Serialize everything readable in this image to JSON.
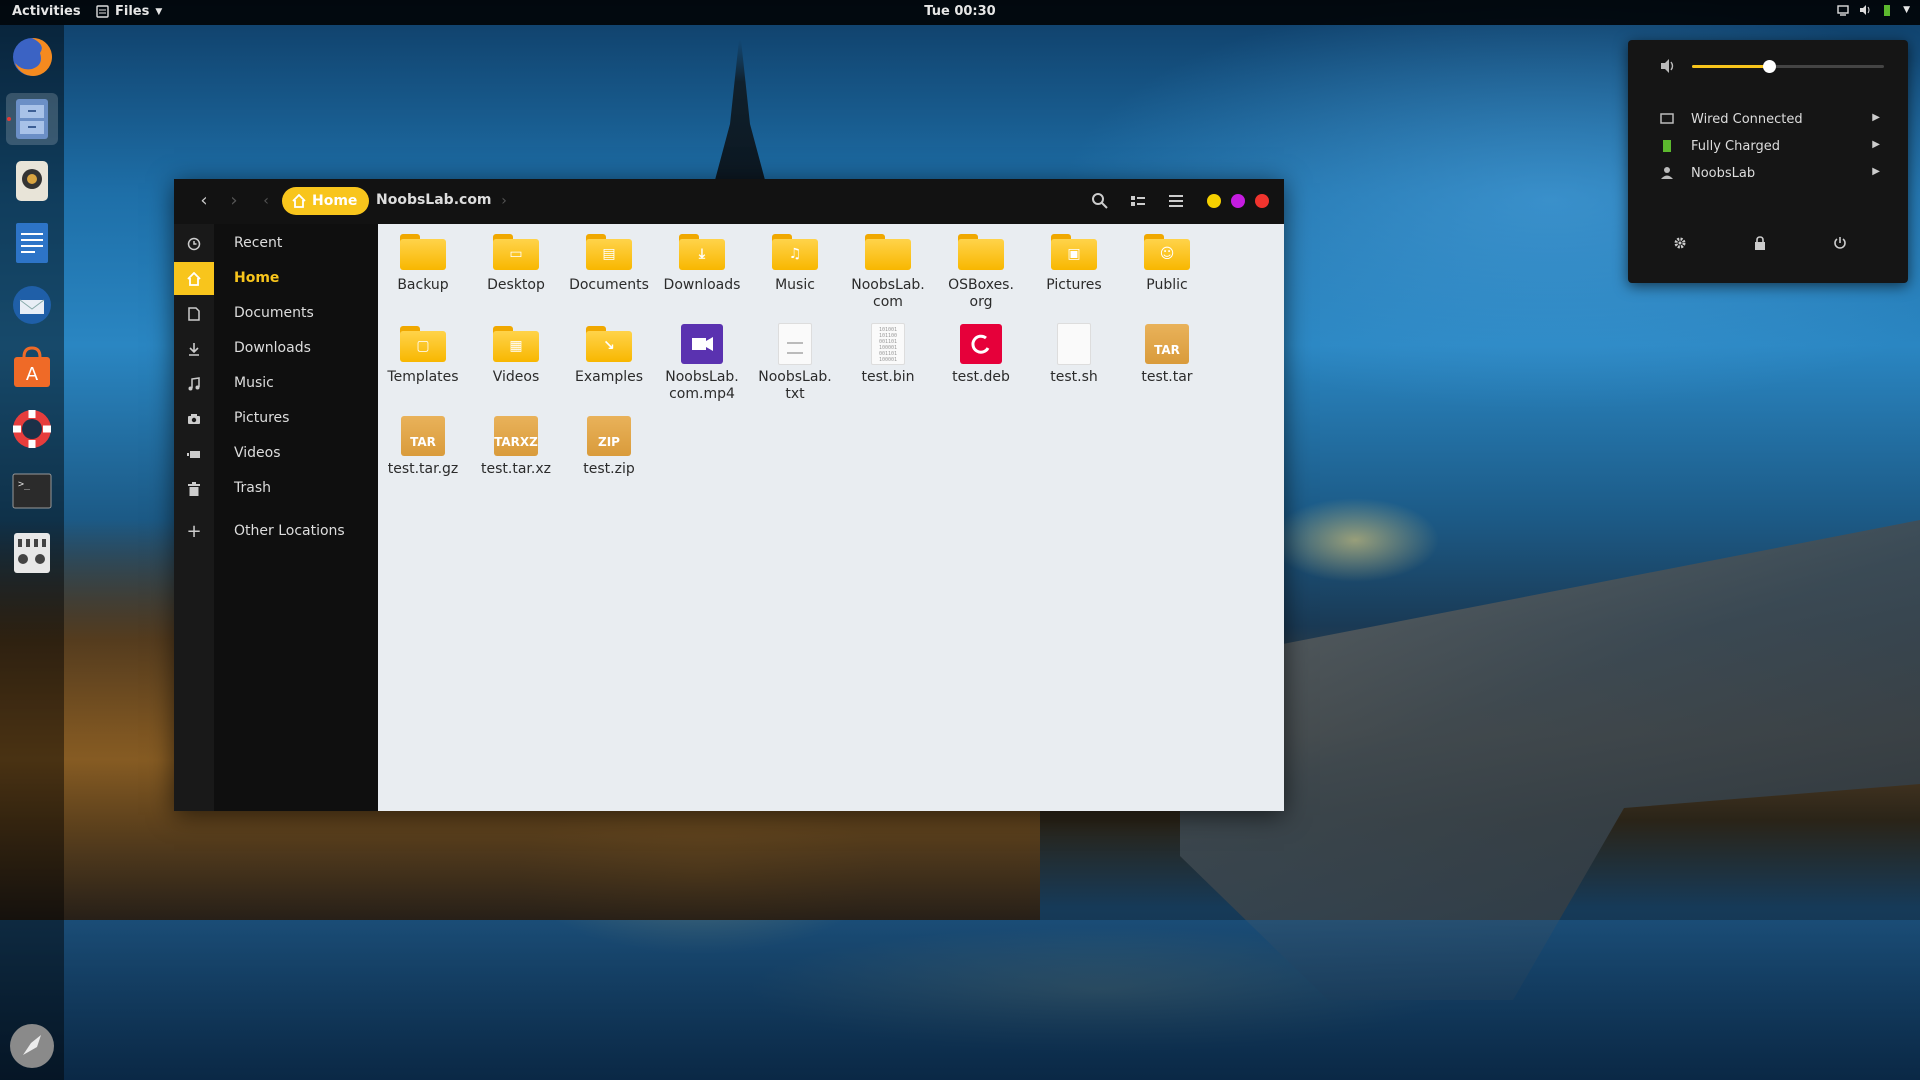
{
  "topbar": {
    "activities": "Activities",
    "app_menu": "Files",
    "clock": "Tue 00:30"
  },
  "dock": {
    "apps": [
      "firefox",
      "files",
      "rhythmbox",
      "libreoffice-writer",
      "thunderbird",
      "software-center",
      "help",
      "terminal",
      "settings",
      "launcher"
    ]
  },
  "window": {
    "breadcrumbs": [
      "Home",
      "NoobsLab.com"
    ],
    "accent_color": "#f8c51c",
    "window_buttons": [
      "#f5d000",
      "#c51ce0",
      "#f0342e"
    ]
  },
  "sidebar": {
    "items": [
      {
        "label": "Recent",
        "icon": "clock-icon"
      },
      {
        "label": "Home",
        "icon": "home-icon",
        "selected": true
      },
      {
        "label": "Documents",
        "icon": "document-icon"
      },
      {
        "label": "Downloads",
        "icon": "download-icon"
      },
      {
        "label": "Music",
        "icon": "music-icon"
      },
      {
        "label": "Pictures",
        "icon": "camera-icon"
      },
      {
        "label": "Videos",
        "icon": "video-icon"
      },
      {
        "label": "Trash",
        "icon": "trash-icon"
      },
      {
        "label": "Other Locations",
        "icon": "plus-icon"
      }
    ]
  },
  "files": [
    {
      "name": "Backup",
      "type": "folder",
      "glyph": ""
    },
    {
      "name": "Desktop",
      "type": "folder",
      "glyph": "▭"
    },
    {
      "name": "Documents",
      "type": "folder",
      "glyph": "▤"
    },
    {
      "name": "Downloads",
      "type": "folder",
      "glyph": "⤓"
    },
    {
      "name": "Music",
      "type": "folder",
      "glyph": "♫"
    },
    {
      "name": "NoobsLab.\ncom",
      "type": "folder",
      "glyph": ""
    },
    {
      "name": "OSBoxes.\norg",
      "type": "folder",
      "glyph": ""
    },
    {
      "name": "Pictures",
      "type": "folder",
      "glyph": "▣"
    },
    {
      "name": "Public",
      "type": "folder",
      "glyph": "☺"
    },
    {
      "name": "Templates",
      "type": "folder",
      "glyph": "▢"
    },
    {
      "name": "Videos",
      "type": "folder",
      "glyph": "▦"
    },
    {
      "name": "Examples",
      "type": "folder",
      "glyph": "↘"
    },
    {
      "name": "NoobsLab.\ncom.mp4",
      "type": "video"
    },
    {
      "name": "NoobsLab.\ntxt",
      "type": "text"
    },
    {
      "name": "test.bin",
      "type": "binary"
    },
    {
      "name": "test.deb",
      "type": "deb"
    },
    {
      "name": "test.sh",
      "type": "script"
    },
    {
      "name": "test.tar",
      "type": "archive",
      "badge": "TAR"
    },
    {
      "name": "test.tar.gz",
      "type": "archive",
      "badge": "TAR"
    },
    {
      "name": "test.tar.xz",
      "type": "archive",
      "badge": "TARXZ"
    },
    {
      "name": "test.zip",
      "type": "archive",
      "badge": "ZIP"
    }
  ],
  "system_menu": {
    "volume_fraction": 0.4,
    "rows": [
      {
        "label": "Wired Connected",
        "icon": "network-icon"
      },
      {
        "label": "Fully Charged",
        "icon": "battery-icon"
      },
      {
        "label": "NoobsLab",
        "icon": "user-icon"
      }
    ],
    "buttons": [
      "settings-icon",
      "lock-icon",
      "power-icon"
    ]
  }
}
